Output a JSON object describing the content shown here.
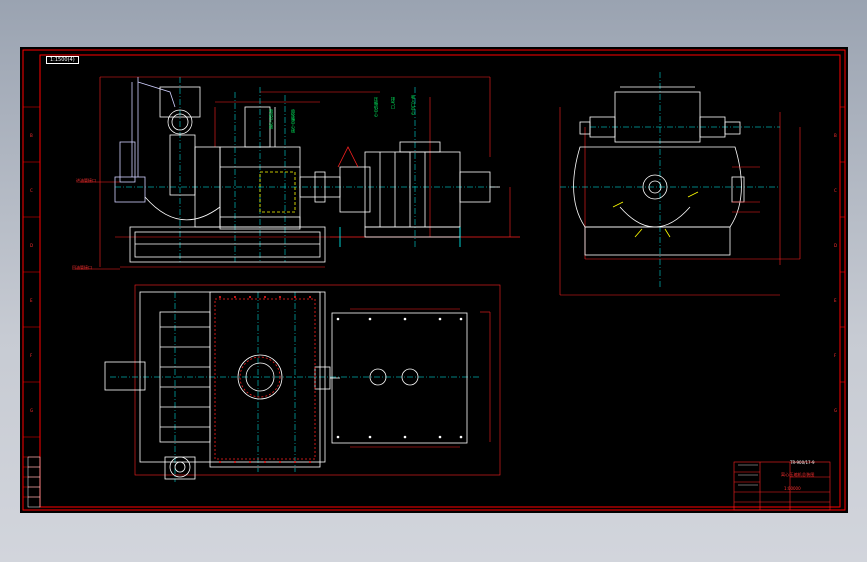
{
  "sheet": {
    "corner_tag": "1:1500(4)",
    "title_block": {
      "drawing_name": "离心压缩机总装图",
      "drawing_code": "TR-900/17-9",
      "sub_text": "1:00000"
    }
  },
  "labels": {
    "left_upper_callout": "进油管接口",
    "left_lower_callout": "回油管接口",
    "vertical_1": "电机中心线",
    "vertical_2": "齿轮箱中心线",
    "vertical_3": "压缩机中心",
    "vertical_4": "排气口",
    "vertical_5": "吸入口中心"
  },
  "colors": {
    "border": "#ff0000",
    "outline": "#ffffff",
    "centerline": "#00ffff",
    "dimension": "#ff2020",
    "highlight": "#ffff00",
    "text_green": "#00ff66",
    "part_lines": "#d0d0ff"
  }
}
